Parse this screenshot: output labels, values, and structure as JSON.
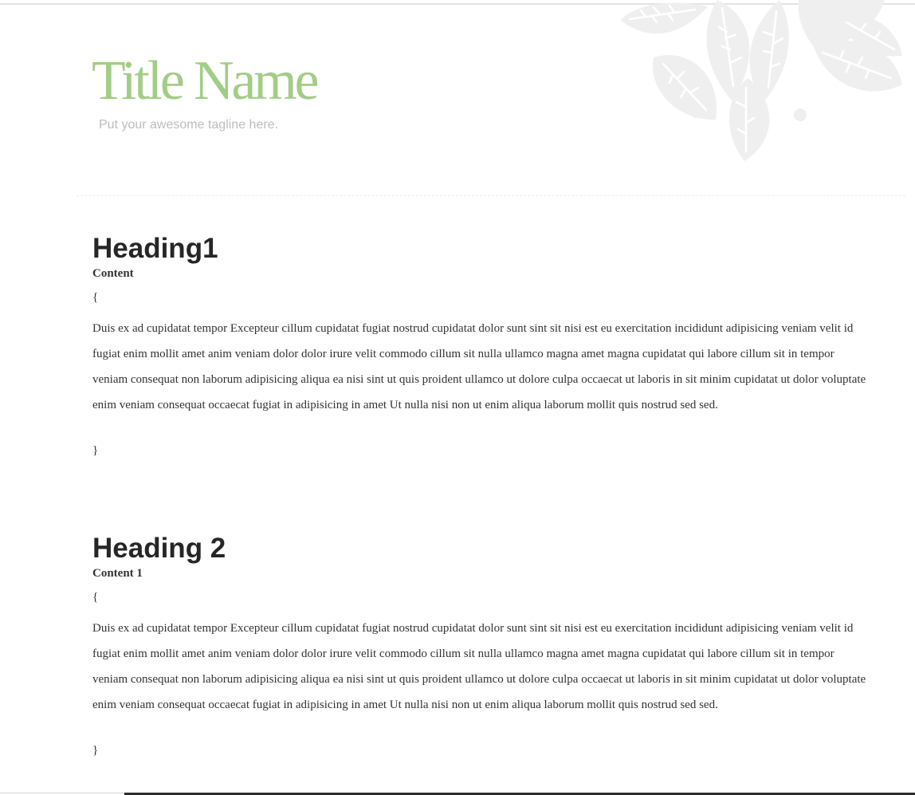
{
  "header": {
    "title": "Title Name",
    "tagline": "Put your awesome tagline here."
  },
  "sections": [
    {
      "heading": "Heading1",
      "subheading": "Content",
      "open_brace": "{",
      "body": "Duis ex ad cupidatat tempor Excepteur cillum cupidatat fugiat nostrud cupidatat dolor sunt sint sit nisi est eu exercitation incididunt adipisicing veniam velit id fugiat enim mollit amet anim veniam dolor dolor irure velit commodo cillum sit nulla ullamco magna amet magna cupidatat qui labore cillum sit in tempor veniam consequat non laborum adipisicing aliqua ea nisi sint ut quis proident ullamco ut dolore culpa occaecat ut laboris in sit minim cupidatat ut dolor voluptate enim veniam consequat occaecat fugiat in adipisicing in amet Ut nulla nisi non ut enim aliqua laborum mollit quis nostrud sed sed.",
      "close_brace": "}"
    },
    {
      "heading": "Heading 2",
      "subheading": "Content 1",
      "open_brace": "{",
      "body": "Duis ex ad cupidatat tempor Excepteur cillum cupidatat fugiat nostrud cupidatat dolor sunt sint sit nisi est eu exercitation incididunt adipisicing veniam velit id fugiat enim mollit amet anim veniam dolor dolor irure velit commodo cillum sit nulla ullamco magna amet magna cupidatat qui labore cillum sit in tempor veniam consequat non laborum adipisicing aliqua ea nisi sint ut quis proident ullamco ut dolore culpa occaecat ut laboris in sit minim cupidatat ut dolor voluptate enim veniam consequat occaecat fugiat in adipisicing in amet Ut nulla nisi non ut enim aliqua laborum mollit quis nostrud sed sed.",
      "close_brace": "}"
    }
  ],
  "decoration": {
    "icon": "leaf-ornament-icon",
    "color": "#eeeeee"
  },
  "colors": {
    "title": "#a3cd86",
    "tagline": "#bdbdbd",
    "heading": "#262626",
    "text": "#333333"
  }
}
